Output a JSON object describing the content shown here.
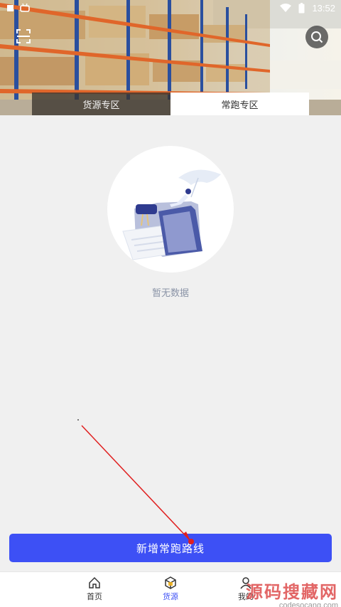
{
  "status_bar": {
    "time": "13:52",
    "carrier_icon": "notification-square-icon",
    "app_icon": "robot-icon"
  },
  "header": {
    "scan_icon": "scan-icon",
    "search_icon": "search-icon",
    "tabs": [
      {
        "label": "货源专区",
        "active": false
      },
      {
        "label": "常跑专区",
        "active": true
      }
    ]
  },
  "empty_state": {
    "text": "暂无数据",
    "illustration_icon": "empty-folder-illustration"
  },
  "action": {
    "add_route_label": "新增常跑路线"
  },
  "bottom_nav": {
    "items": [
      {
        "label": "首页",
        "icon": "home-icon",
        "active": false
      },
      {
        "label": "货源",
        "icon": "box-icon",
        "active": true
      },
      {
        "label": "我的",
        "icon": "user-icon",
        "active": false
      }
    ]
  },
  "watermark": {
    "title": "源码搜藏网",
    "url": "codesocang.com"
  },
  "colors": {
    "primary": "#3d50f5",
    "background": "#f0f0f0",
    "empty_text": "#8a93a6",
    "annotation": "#e02020"
  }
}
